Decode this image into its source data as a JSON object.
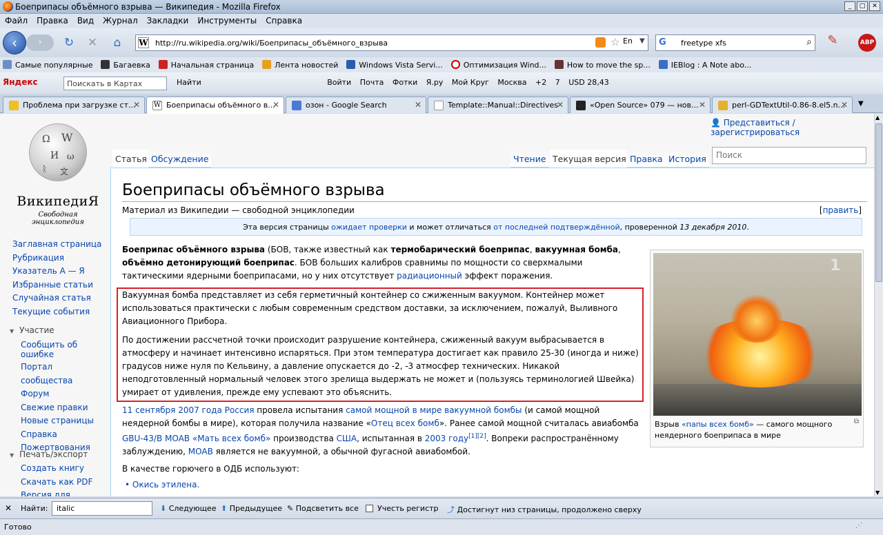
{
  "window": {
    "title": "Боеприпасы объёмного взрыва — Википедия - Mozilla Firefox"
  },
  "menu": [
    "Файл",
    "Правка",
    "Вид",
    "Журнал",
    "Закладки",
    "Инструменты",
    "Справка"
  ],
  "nav": {
    "url": "http://ru.wikipedia.org/wiki/Боеприпасы_объёмного_взрыва",
    "lang": "En",
    "search_value": "freetype xfs",
    "abp": "ABP"
  },
  "bookmarks": [
    "Самые популярные",
    "Багаевка",
    "Начальная страница",
    "Лента новостей",
    "Windows Vista Servi...",
    "Оптимизация Wind...",
    "How to move the sp...",
    "IEBlog : A Note abo..."
  ],
  "yandex": {
    "logo": "Яндекс",
    "map_placeholder": "Поискать в Картах",
    "find": "Найти",
    "items": [
      "Войти",
      "Почта",
      "Фотки",
      "Я.ру",
      "Мой Круг",
      "Москва",
      "+2",
      "7",
      "USD 28,43"
    ]
  },
  "tabs": [
    {
      "label": "Проблема при загрузке ст..."
    },
    {
      "label": "Боеприпасы объёмного в..."
    },
    {
      "label": "озон - Google Search"
    },
    {
      "label": "Template::Manual::Directives"
    },
    {
      "label": "«Open Source» 079 — нов..."
    },
    {
      "label": "perl-GDTextUtil-0.86-8.el5.n..."
    }
  ],
  "wiki": {
    "personal": "Представиться / зарегистрироваться",
    "logo_name": "ВикипедиЯ",
    "logo_sub": "Свободная энциклопедия",
    "nav_links": [
      "Заглавная страница",
      "Рубрикация",
      "Указатель А — Я",
      "Избранные статьи",
      "Случайная статья",
      "Текущие события"
    ],
    "participation_head": "Участие",
    "participation_links": [
      "Сообщить об ошибке",
      "Портал сообщества",
      "Форум",
      "Свежие правки",
      "Новые страницы",
      "Справка",
      "Пожертвования"
    ],
    "print_head": "Печать/экспорт",
    "print_links": [
      "Создать книгу",
      "Скачать как PDF",
      "Версия для печати"
    ],
    "tab_article": "Статья",
    "tab_talk": "Обсуждение",
    "tab_read": "Чтение",
    "tab_current": "Текущая версия",
    "tab_edit": "Правка",
    "tab_history": "История",
    "search_placeholder": "Поиск",
    "title": "Боеприпасы объёмного взрыва",
    "subtitle": "Материал из Википедии — свободной энциклопедии",
    "edit_link": "править",
    "notice": {
      "a": "Эта версия страницы ",
      "link1": "ожидает проверки",
      "b": " и может отличаться ",
      "link2": "от последней подтверждённой",
      "c": ", проверенной ",
      "date": "13 декабря 2010",
      "d": "."
    },
    "p1": {
      "b1": "Боеприпас объёмного взрыва",
      "t1": " (БОВ, также известный как ",
      "b2": "термобарический боеприпас",
      "t2": ", ",
      "b3": "вакуумная бомба",
      "t3": ", ",
      "b4": "объёмно детонирующий боеприпас",
      "t4": ". БОВ больших калибров сравнимы по мощности со сверхмалыми тактическими ядерными боеприпасами, но у них отсутствует ",
      "link": "радиационный",
      "t5": " эффект поражения."
    },
    "p2": "Вакуумная бомба представляет из себя герметичный контейнер со сжиженным вакуумом. Контейнер может использоваться практически с любым современным средством доставки, за исключением, пожалуй, Выливного Авиационного Прибора.",
    "p3": "По достижении рассчетной точки происходит разрушение контейнера, сжиженный вакуум выбрасывается в атмосферу и начинает интенсивно испаряться. При этом температура достигает как правило 25-30 (иногда и ниже) градусов ниже нуля по Кельвину, а давление опускается до -2, -3 атмосфер технических. Никакой неподготовленный нормальный человек этого зрелища выдержать не может и (пользуясь терминологией Швейка) умирает от удивления, прежде ему успевают это объяснить.",
    "p4": {
      "l1": "11 сентября",
      "l2": "2007 года",
      "l3": "Россия",
      "t1": " провела испытания ",
      "l4": "самой мощной в мире вакуумной бомбы",
      "t2": " (и самой мощной неядерной бомбы в мире), которая получила название «",
      "l5": "Отец всех бомб",
      "t3": "». Ранее самой мощной считалась авиабомба ",
      "l6": "GBU-43/B MOAB",
      "t4": " ",
      "l7": "«Мать всех бомб»",
      "t5": " производства ",
      "l8": "США",
      "t6": ", испытанная в ",
      "l9": "2003 году",
      "s1": "[1]",
      "s2": "[2]",
      "t7": ". Вопреки распространённому заблуждению, ",
      "l10": "MOAB",
      "t8": " является не вакуумной, а обычной фугасной авиабомбой."
    },
    "p5": "В качестве горючего в ОДБ используют:",
    "list": [
      "Окись этилена."
    ],
    "caption": {
      "a": "Взрыв ",
      "link": "«папы всех бомб»",
      "b": " — самого мощного неядерного боеприпаса в мире"
    }
  },
  "findbar": {
    "label": "Найти:",
    "value": "italic",
    "next": "Следующее",
    "prev": "Предыдущее",
    "highlight": "Подсветить все",
    "matchcase": "Учесть регистр",
    "status": "Достигнут низ страницы, продолжено сверху"
  },
  "status": "Готово"
}
